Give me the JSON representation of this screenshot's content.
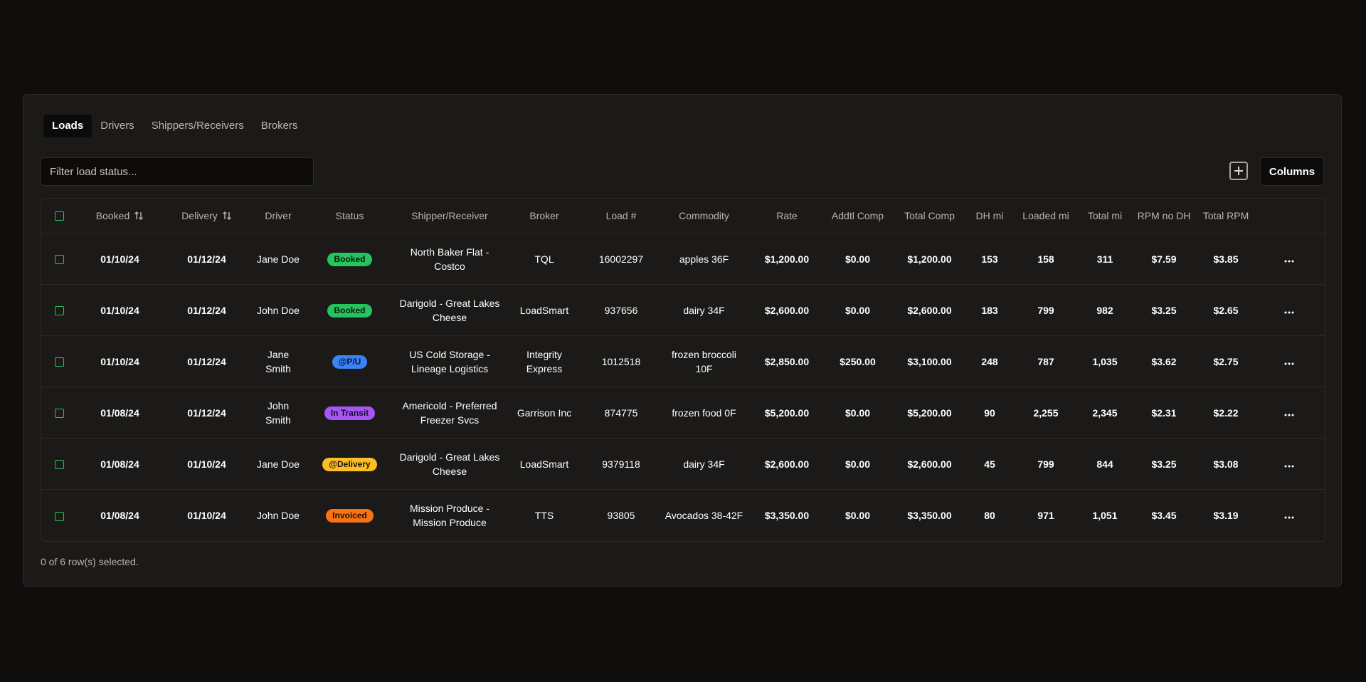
{
  "tabs": [
    {
      "label": "Loads",
      "active": true
    },
    {
      "label": "Drivers",
      "active": false
    },
    {
      "label": "Shippers/Receivers",
      "active": false
    },
    {
      "label": "Brokers",
      "active": false
    }
  ],
  "filter": {
    "placeholder": "Filter load status..."
  },
  "toolbar": {
    "add_icon": "plus-square-icon",
    "columns_label": "Columns"
  },
  "table": {
    "headers": {
      "booked": "Booked",
      "delivery": "Delivery",
      "driver": "Driver",
      "status": "Status",
      "shipper": "Shipper/Receiver",
      "broker": "Broker",
      "load": "Load #",
      "commodity": "Commodity",
      "rate": "Rate",
      "addtl": "Addtl Comp",
      "total_comp": "Total Comp",
      "dh": "DH mi",
      "loaded": "Loaded mi",
      "total_mi": "Total mi",
      "rpm_no_dh": "RPM no DH",
      "total_rpm": "Total RPM"
    },
    "row_menu_icon": "more-horizontal-icon",
    "rows": [
      {
        "booked": "01/10/24",
        "delivery": "01/12/24",
        "driver": "Jane Doe",
        "status": "Booked",
        "status_color": "#22c55e",
        "shipper": "North Baker Flat - Costco",
        "broker": "TQL",
        "load": "16002297",
        "commodity": "apples 36F",
        "rate": "$1,200.00",
        "addtl": "$0.00",
        "total_comp": "$1,200.00",
        "dh": "153",
        "loaded": "158",
        "total_mi": "311",
        "rpm_no_dh": "$7.59",
        "total_rpm": "$3.85"
      },
      {
        "booked": "01/10/24",
        "delivery": "01/12/24",
        "driver": "John Doe",
        "status": "Booked",
        "status_color": "#22c55e",
        "shipper": "Darigold - Great Lakes Cheese",
        "broker": "LoadSmart",
        "load": "937656",
        "commodity": "dairy 34F",
        "rate": "$2,600.00",
        "addtl": "$0.00",
        "total_comp": "$2,600.00",
        "dh": "183",
        "loaded": "799",
        "total_mi": "982",
        "rpm_no_dh": "$3.25",
        "total_rpm": "$2.65"
      },
      {
        "booked": "01/10/24",
        "delivery": "01/12/24",
        "driver": "Jane Smith",
        "status": "@P/U",
        "status_color": "#3b82f6",
        "shipper": "US Cold Storage - Lineage Logistics",
        "broker": "Integrity Express",
        "load": "1012518",
        "commodity": "frozen broccoli 10F",
        "rate": "$2,850.00",
        "addtl": "$250.00",
        "total_comp": "$3,100.00",
        "dh": "248",
        "loaded": "787",
        "total_mi": "1,035",
        "rpm_no_dh": "$3.62",
        "total_rpm": "$2.75"
      },
      {
        "booked": "01/08/24",
        "delivery": "01/12/24",
        "driver": "John Smith",
        "status": "In Transit",
        "status_color": "#a855f7",
        "shipper": "Americold - Preferred Freezer Svcs",
        "broker": "Garrison Inc",
        "load": "874775",
        "commodity": "frozen food 0F",
        "rate": "$5,200.00",
        "addtl": "$0.00",
        "total_comp": "$5,200.00",
        "dh": "90",
        "loaded": "2,255",
        "total_mi": "2,345",
        "rpm_no_dh": "$2.31",
        "total_rpm": "$2.22"
      },
      {
        "booked": "01/08/24",
        "delivery": "01/10/24",
        "driver": "Jane Doe",
        "status": "@Delivery",
        "status_color": "#fbbf24",
        "shipper": "Darigold - Great Lakes Cheese",
        "broker": "LoadSmart",
        "load": "9379118",
        "commodity": "dairy 34F",
        "rate": "$2,600.00",
        "addtl": "$0.00",
        "total_comp": "$2,600.00",
        "dh": "45",
        "loaded": "799",
        "total_mi": "844",
        "rpm_no_dh": "$3.25",
        "total_rpm": "$3.08"
      },
      {
        "booked": "01/08/24",
        "delivery": "01/10/24",
        "driver": "John Doe",
        "status": "Invoiced",
        "status_color": "#f97316",
        "shipper": "Mission Produce - Mission Produce",
        "broker": "TTS",
        "load": "93805",
        "commodity": "Avocados 38-42F",
        "rate": "$3,350.00",
        "addtl": "$0.00",
        "total_comp": "$3,350.00",
        "dh": "80",
        "loaded": "971",
        "total_mi": "1,051",
        "rpm_no_dh": "$3.45",
        "total_rpm": "$3.19"
      }
    ]
  },
  "footer": {
    "selection_text": "0 of 6 row(s) selected."
  }
}
